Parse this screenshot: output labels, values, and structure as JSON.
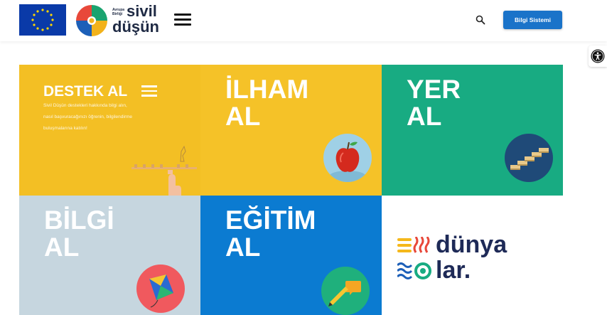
{
  "header": {
    "brand_prefix": "Avrupa Birliği",
    "brand_word1": "sivil",
    "brand_word2": "düşün",
    "cta_label": "Bilgi Sistemi"
  },
  "tiles": {
    "destek": {
      "title": "DESTEK AL",
      "description": "Sivil Düşün destekleri hakkında bilgi alın, nasıl başvuracağınızı öğrenin, bilgilendirme buluşmalarına katılın!"
    },
    "ilham": {
      "line1": "İLHAM",
      "line2": "AL"
    },
    "yer": {
      "line1": "YER",
      "line2": "AL"
    },
    "bilgi": {
      "line1": "BİLGİ",
      "line2": "AL"
    },
    "egitim": {
      "line1": "EĞİTİM",
      "line2": "AL"
    },
    "dunyalar": {
      "line1": "dünya",
      "line2": "lar."
    }
  },
  "colors": {
    "eu_blue": "#0a3aa8",
    "eu_star": "#ffd700",
    "cta_blue": "#1a73c9",
    "tile_yellow": "#f3bf24",
    "tile_green": "#18ab82",
    "tile_grey": "#c6d6df",
    "tile_blue": "#0b7bd1",
    "dunya_navy": "#1e2a57"
  },
  "icons": [
    "eu-flag-logo",
    "sivil-dusun-puzzle-logo",
    "hamburger-menu-icon",
    "search-icon",
    "accessibility-icon",
    "apple-icon",
    "stairs-icon",
    "kite-icon",
    "pencil-note-icon",
    "waves-spiral-icon"
  ]
}
